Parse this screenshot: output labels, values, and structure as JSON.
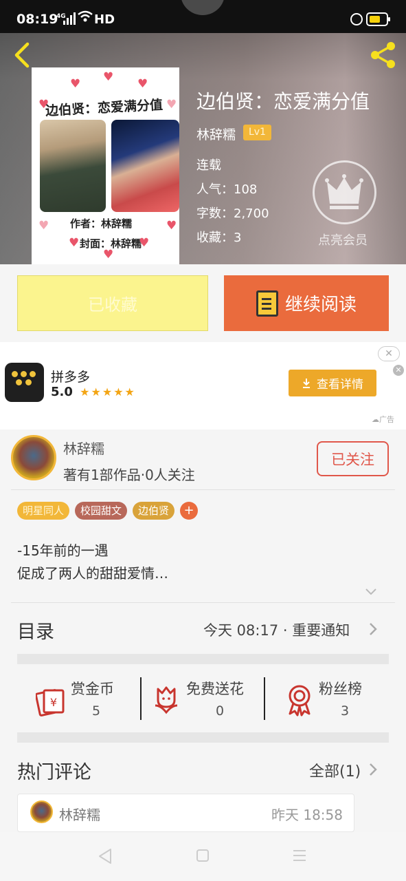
{
  "status_bar": {
    "time": "08:19",
    "network": "4G",
    "hd": "HD"
  },
  "book": {
    "title": "边伯贤：恋爱满分值",
    "author": "林辞糯",
    "author_level": "Lv1",
    "status": "连载",
    "popularity": "人气：108",
    "word_count": "字数：2,700",
    "favorites": "收藏：3",
    "vip_label": "点亮会员",
    "cover": {
      "title_text": "边伯贤：恋爱满分值",
      "author_text": "作者：林辞糯",
      "cover_text": "封面：林辞糯"
    }
  },
  "actions": {
    "favorite_label": "已收藏",
    "read_label": "继续阅读"
  },
  "ad": {
    "app_name": "拼多多",
    "rating": "5.0",
    "stars": "★★★★★",
    "button_label": "查看详情",
    "tag": "广告",
    "close": "✕",
    "x": "✕"
  },
  "author_card": {
    "name": "林辞糯",
    "description": "著有1部作品·0人关注",
    "follow_label": "已关注"
  },
  "tags": [
    {
      "label": "明星同人",
      "bg": "#f2b739",
      "color": "#fff5d5"
    },
    {
      "label": "校园甜文",
      "bg": "#b8685a",
      "color": "#ffffff"
    },
    {
      "label": "边伯贤",
      "bg": "#d9a33a",
      "color": "#ffffff"
    }
  ],
  "tag_more": "+",
  "intro": {
    "line1": "-15年前的一遇",
    "line2": "促成了两人的甜甜爱情…"
  },
  "catalog": {
    "title": "目录",
    "latest": "今天 08:17 · 重要通知"
  },
  "stats": [
    {
      "label": "赏金币",
      "value": "5",
      "icon": "red-envelope-icon"
    },
    {
      "label": "免费送花",
      "value": "0",
      "icon": "flower-icon"
    },
    {
      "label": "粉丝榜",
      "value": "3",
      "icon": "medal-icon"
    }
  ],
  "comments": {
    "title": "热门评论",
    "all_label": "全部(1)",
    "items": [
      {
        "user": "林辞糯",
        "time": "昨天 18:58"
      }
    ]
  },
  "colors": {
    "accent": "#ea6b3d",
    "gold": "#f2b739",
    "favorite_bg": "#fbf48e",
    "icon_red": "#c8352e"
  }
}
